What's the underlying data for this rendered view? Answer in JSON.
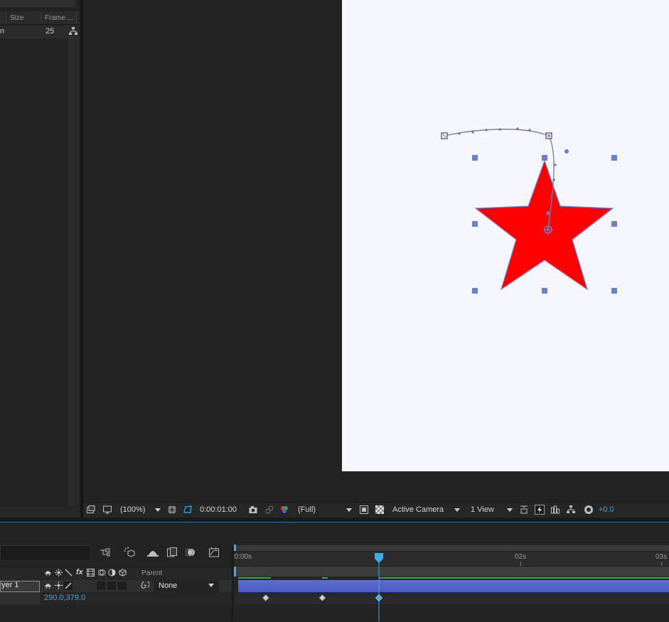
{
  "project_panel": {
    "col_size": "Size",
    "col_frame": "Frame ...",
    "row_name": "n",
    "row_frame": "25",
    "flowchart_icon": "flowchart-icon"
  },
  "viewer_toolbar": {
    "zoom": "(100%)",
    "timecode": "0:00:01:00",
    "resolution": "(Full)",
    "camera": "Active Camera",
    "views": "1 View",
    "exposure": "+0.0"
  },
  "timeline": {
    "col_parent": "Parent",
    "layer_name": "yer 1",
    "parent_value": "None",
    "property_value": "290.0,379.0",
    "ruler": [
      "0:00s",
      "02s",
      "03s"
    ],
    "keyframe_times_s": [
      0.2,
      0.6,
      1.0
    ],
    "current_time_s": 1.0
  },
  "colors": {
    "star_fill": "#ff0000",
    "handle": "#6b7fd3",
    "accent": "#3fa9e8",
    "comp_bg": "#f5f7fc"
  }
}
